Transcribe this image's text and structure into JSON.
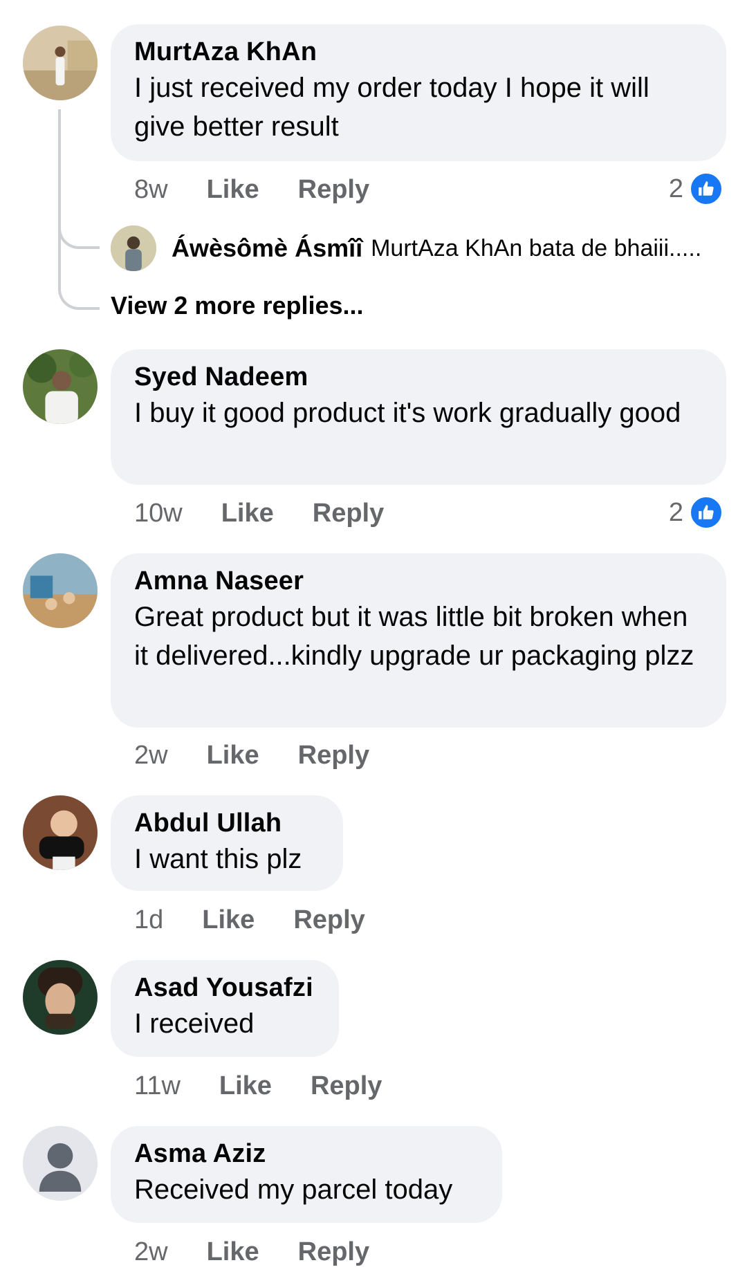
{
  "comments": [
    {
      "author": "MurtAza KhAn",
      "text": "I just received my order today I hope it will give better result",
      "age": "8w",
      "like_label": "Like",
      "reply_label": "Reply",
      "reaction_count": "2",
      "reply_preview": {
        "author": "Áwèsômè Ásmîî",
        "text": "MurtAza KhAn bata de bhaiii....."
      },
      "view_more": "View 2 more replies..."
    },
    {
      "author": "Syed Nadeem",
      "text": "I buy it good product it's work gradually good",
      "age": "10w",
      "like_label": "Like",
      "reply_label": "Reply",
      "reaction_count": "2"
    },
    {
      "author": "Amna Naseer",
      "text": "Great product but it was little bit  broken when it delivered...kindly upgrade ur packaging plzz",
      "age": "2w",
      "like_label": "Like",
      "reply_label": "Reply"
    },
    {
      "author": "Abdul Ullah",
      "text": "I want this plz",
      "age": "1d",
      "like_label": "Like",
      "reply_label": "Reply"
    },
    {
      "author": "Asad Yousafzi",
      "text": "I received",
      "age": "11w",
      "like_label": "Like",
      "reply_label": "Reply"
    },
    {
      "author": "Asma Aziz",
      "text": "Received my parcel today",
      "age": "2w",
      "like_label": "Like",
      "reply_label": "Reply"
    }
  ],
  "colors": {
    "bubble": "#f0f2f5",
    "meta_text": "#65676b",
    "like_badge": "#1877f2",
    "thread_line": "#ced0d4"
  },
  "icons": {
    "reaction": "thumbs-up-icon",
    "default_avatar": "person-silhouette-icon"
  }
}
